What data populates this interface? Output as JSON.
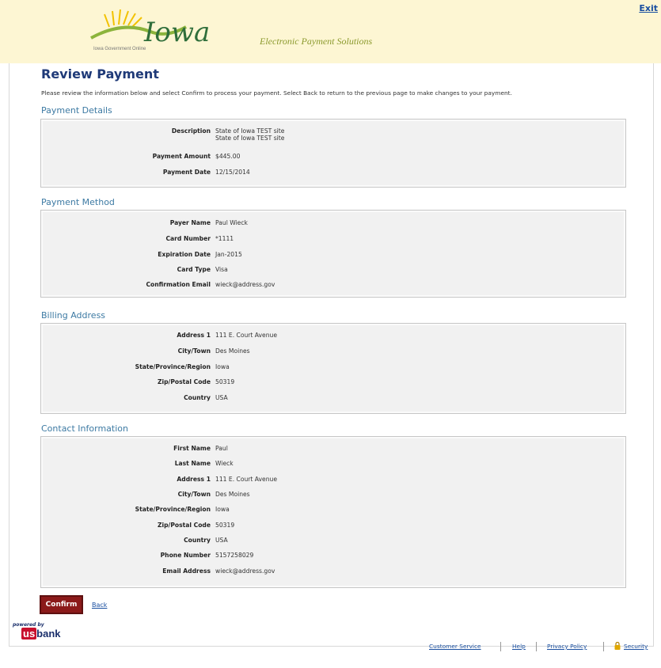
{
  "header": {
    "logo_text": "Iowa",
    "gov_online": "Iowa Government Online",
    "tagline": "Electronic Payment Solutions",
    "exit_label": "Exit"
  },
  "page": {
    "title": "Review Payment",
    "instructions": "Please review the information below and select Confirm to process your payment. Select Back to return to the previous page to make changes to your payment."
  },
  "payment_details": {
    "title": "Payment Details",
    "description_label": "Description",
    "description_line1": "State of Iowa TEST site",
    "description_line2": "State of Iowa TEST site",
    "amount_label": "Payment Amount",
    "amount": "$445.00",
    "date_label": "Payment Date",
    "date": "12/15/2014"
  },
  "payment_method": {
    "title": "Payment Method",
    "rows": [
      {
        "label": "Payer Name",
        "value": "Paul Wieck"
      },
      {
        "label": "Card Number",
        "value": "*1111"
      },
      {
        "label": "Expiration Date",
        "value": "Jan-2015"
      },
      {
        "label": "Card Type",
        "value": "Visa"
      },
      {
        "label": "Confirmation Email",
        "value": "wieck@address.gov"
      }
    ]
  },
  "billing_address": {
    "title": "Billing Address",
    "rows": [
      {
        "label": "Address 1",
        "value": "111 E. Court Avenue"
      },
      {
        "label": "City/Town",
        "value": "Des Moines"
      },
      {
        "label": "State/Province/Region",
        "value": "Iowa"
      },
      {
        "label": "Zip/Postal Code",
        "value": "50319"
      },
      {
        "label": "Country",
        "value": "USA"
      }
    ]
  },
  "contact_information": {
    "title": "Contact Information",
    "rows": [
      {
        "label": "First Name",
        "value": "Paul"
      },
      {
        "label": "Last Name",
        "value": "Wieck"
      },
      {
        "label": "Address 1",
        "value": "111 E. Court Avenue"
      },
      {
        "label": "City/Town",
        "value": "Des Moines"
      },
      {
        "label": "State/Province/Region",
        "value": "Iowa"
      },
      {
        "label": "Zip/Postal Code",
        "value": "50319"
      },
      {
        "label": "Country",
        "value": "USA"
      },
      {
        "label": "Phone Number",
        "value": "5157258029"
      },
      {
        "label": "Email Address",
        "value": "wieck@address.gov"
      }
    ]
  },
  "actions": {
    "confirm_label": "Confirm",
    "back_label": "Back"
  },
  "footer": {
    "powered_by": "powered by",
    "usbank_us": "us",
    "usbank_bank": "bank",
    "links": {
      "customer_service": "Customer Service",
      "help": "Help",
      "privacy_policy": "Privacy Policy",
      "security": "Security"
    }
  },
  "colors": {
    "header_bg": "#fdf6d3",
    "title": "#1f3a78",
    "section_title": "#3d7aa3",
    "confirm_button": "#8b1a1a",
    "link": "#1a4fa0"
  },
  "icons": [
    "iowa-logo-icon",
    "lock-icon",
    "usbank-logo-icon"
  ]
}
